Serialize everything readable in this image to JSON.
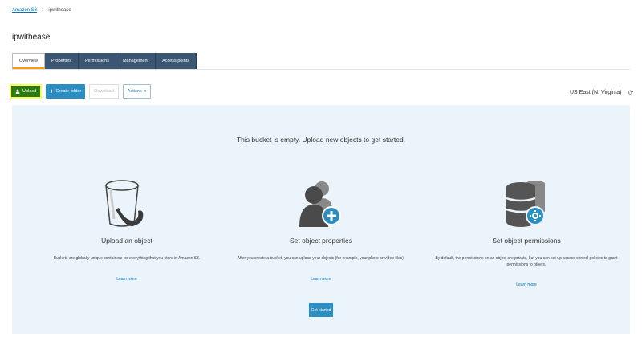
{
  "breadcrumb": {
    "root": "Amazon S3",
    "separator": "›",
    "current": "ipwithease"
  },
  "bucket": {
    "name": "ipwithease"
  },
  "tabs": [
    {
      "label": "Overview",
      "active": true
    },
    {
      "label": "Properties",
      "active": false
    },
    {
      "label": "Permissions",
      "active": false
    },
    {
      "label": "Management",
      "active": false
    },
    {
      "label": "Access points",
      "active": false
    }
  ],
  "toolbar": {
    "upload_label": "Upload",
    "create_folder_label": "Create folder",
    "download_label": "Download",
    "actions_label": "Actions"
  },
  "region": {
    "label": "US East (N. Virginia)"
  },
  "panel": {
    "empty_message": "This bucket is empty. Upload new objects to get started.",
    "columns": [
      {
        "icon": "bucket-icon",
        "title": "Upload an object",
        "description": "Buckets are globally unique containers for everything that you store in Amazon S3.",
        "link": "Learn more"
      },
      {
        "icon": "user-add-icon",
        "title": "Set object properties",
        "description": "After you create a bucket, you can upload your objects (for example, your photo or video files).",
        "link": "Learn more"
      },
      {
        "icon": "database-settings-icon",
        "title": "Set object permissions",
        "description": "By default, the permissions on an object are private, but you can set up access control policies to grant permissions to others.",
        "link": "Learn more"
      }
    ],
    "get_started_label": "Get started"
  },
  "colors": {
    "tab_bg": "#3a5673",
    "accent": "#ff9900",
    "upload_bg": "#2c7a14",
    "primary": "#2a8ec2",
    "panel_bg": "#eaf4fa",
    "link": "#0073bb"
  }
}
